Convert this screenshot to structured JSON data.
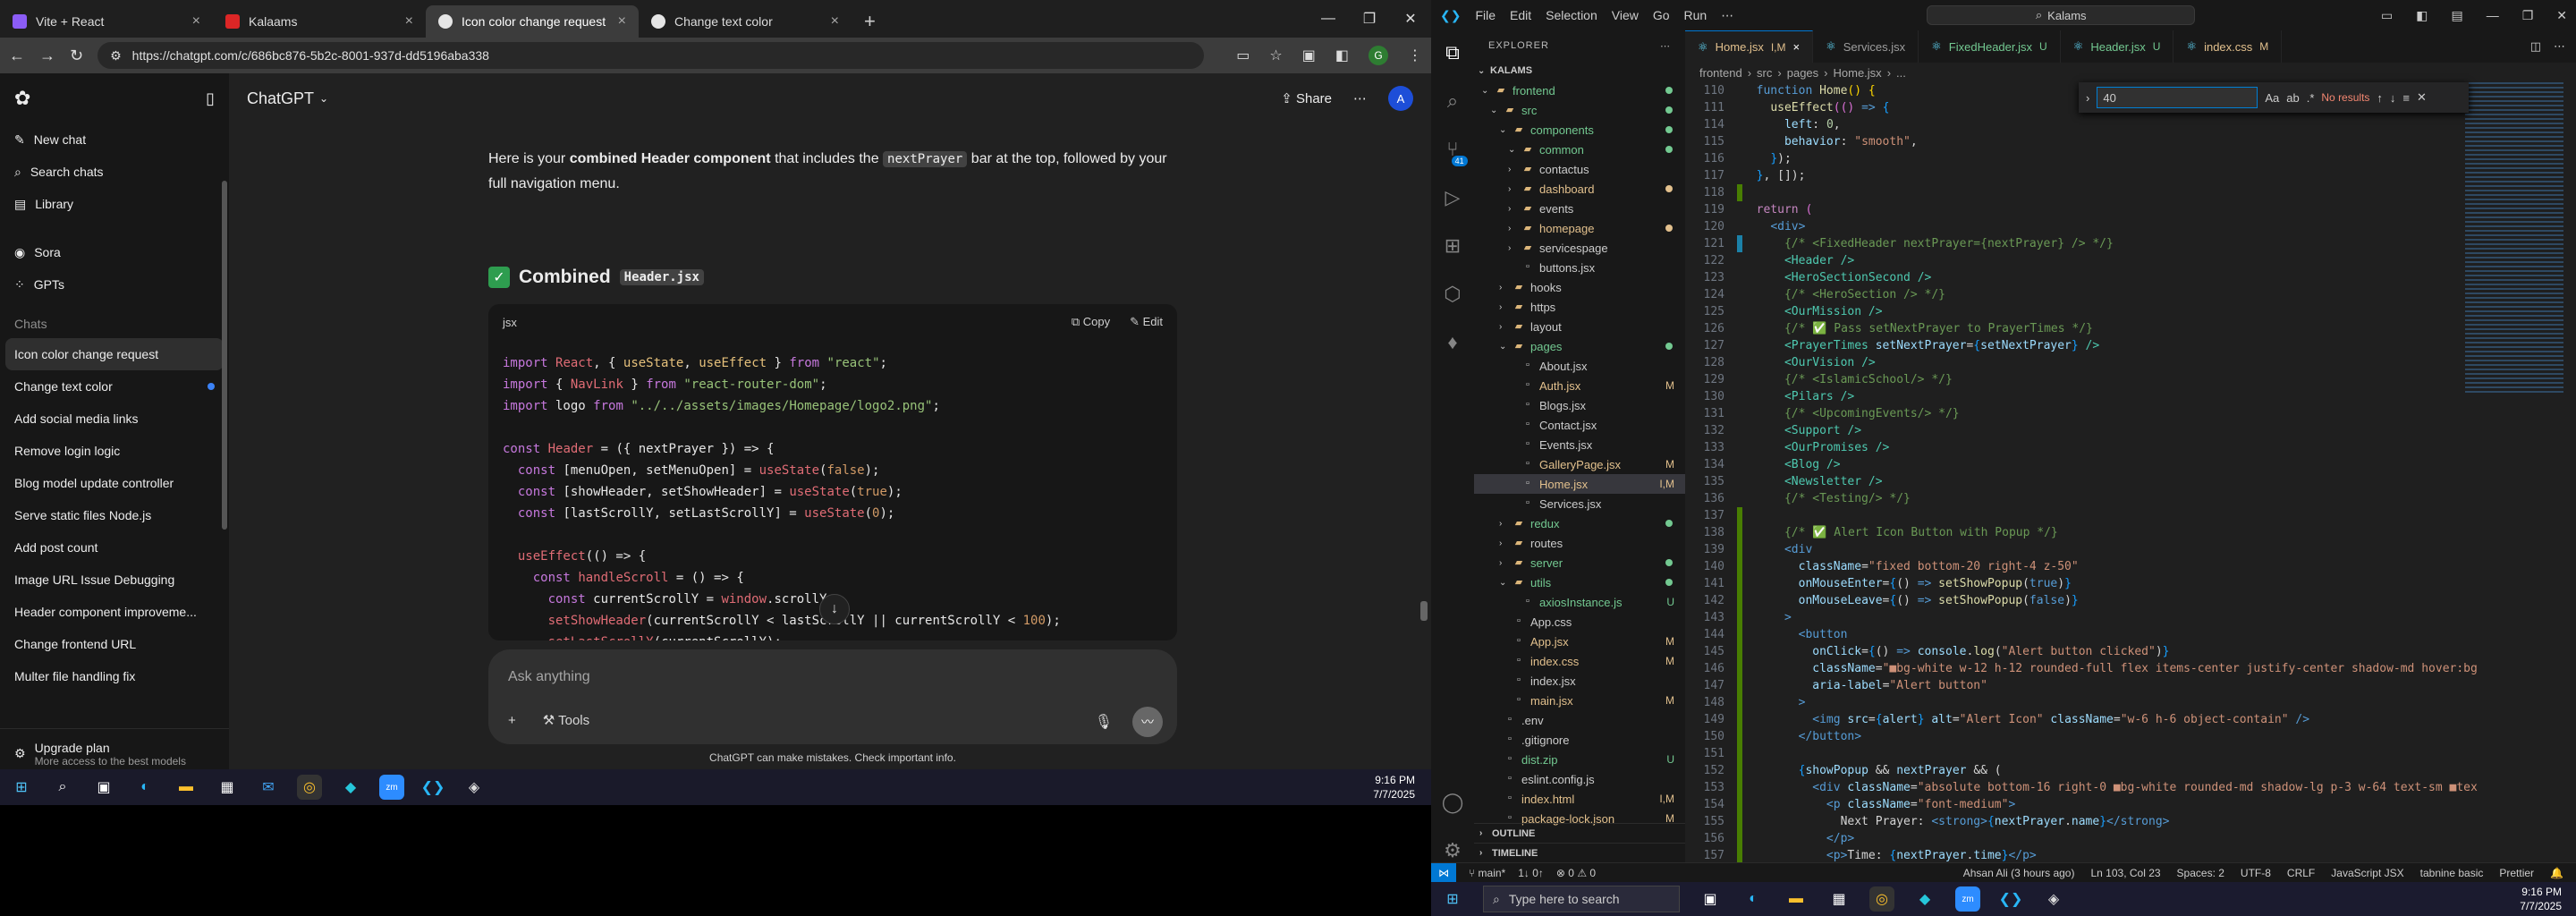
{
  "browser": {
    "tabs": [
      {
        "label": "Vite + React",
        "color": "#8b5cf6"
      },
      {
        "label": "Kalaams",
        "color": "#dc2626"
      },
      {
        "label": "Icon color change request",
        "color": "#e5e5e5"
      },
      {
        "label": "Change text color",
        "color": "#e5e5e5"
      }
    ],
    "url": "https://chatgpt.com/c/686bc876-5b2c-8001-937d-dd5196aba338",
    "profile_initial": "G"
  },
  "chatgpt": {
    "sidebar": {
      "top": [
        {
          "label": "New chat",
          "icon": "new-chat-icon"
        },
        {
          "label": "Search chats",
          "icon": "search-icon"
        },
        {
          "label": "Library",
          "icon": "library-icon"
        }
      ],
      "apps": [
        {
          "label": "Sora",
          "icon": "sora-icon"
        },
        {
          "label": "GPTs",
          "icon": "gpts-icon"
        }
      ],
      "chats_heading": "Chats",
      "chats": [
        "Icon color change request",
        "Change text color",
        "Add social media links",
        "Remove login logic",
        "Blog model update controller",
        "Serve static files Node.js",
        "Add post count",
        "Image URL Issue Debugging",
        "Header component improveme...",
        "Change frontend URL",
        "Multer file handling fix"
      ],
      "upgrade_title": "Upgrade plan",
      "upgrade_sub": "More access to the best models"
    },
    "model": "ChatGPT",
    "share_label": "Share",
    "user_initial": "A",
    "intro_pre": "Here is your ",
    "intro_bold": "combined Header component",
    "intro_mid": " that includes the ",
    "intro_code": "nextPrayer",
    "intro_post": " bar at the top, followed by your full navigation menu.",
    "heading_pre": "Combined",
    "heading_code": "Header.jsx",
    "code_lang": "jsx",
    "copy_label": "Copy",
    "edit_label": "Edit",
    "composer_placeholder": "Ask anything",
    "tools_label": "Tools",
    "disclaimer": "ChatGPT can make mistakes. Check important info."
  },
  "taskbar_left": {
    "time": "9:16 PM",
    "date": "7/7/2025"
  },
  "vscode": {
    "title_search": "Kalams",
    "menu": [
      "File",
      "Edit",
      "Selection",
      "View",
      "Go",
      "Run"
    ],
    "explorer_title": "EXPLORER",
    "root": "KALAMS",
    "tree": [
      {
        "name": "frontend",
        "type": "folder",
        "depth": 0,
        "open": true,
        "status": "",
        "color": "#73c991"
      },
      {
        "name": "src",
        "type": "folder",
        "depth": 1,
        "open": true,
        "status": "",
        "color": "#73c991"
      },
      {
        "name": "components",
        "type": "folder",
        "depth": 2,
        "open": true,
        "status": "",
        "color": "#73c991"
      },
      {
        "name": "common",
        "type": "folder",
        "depth": 3,
        "open": true,
        "status": "",
        "color": "#73c991"
      },
      {
        "name": "contactus",
        "type": "folder",
        "depth": 3,
        "open": false,
        "status": "",
        "color": ""
      },
      {
        "name": "dashboard",
        "type": "folder",
        "depth": 3,
        "open": false,
        "status": "",
        "color": "#e2c08d"
      },
      {
        "name": "events",
        "type": "folder",
        "depth": 3,
        "open": false,
        "status": "",
        "color": ""
      },
      {
        "name": "homepage",
        "type": "folder",
        "depth": 3,
        "open": false,
        "status": "",
        "color": "#e2c08d"
      },
      {
        "name": "servicespage",
        "type": "folder",
        "depth": 3,
        "open": false,
        "status": "",
        "color": ""
      },
      {
        "name": "buttons.jsx",
        "type": "file",
        "depth": 3,
        "open": false,
        "status": "",
        "color": ""
      },
      {
        "name": "hooks",
        "type": "folder",
        "depth": 2,
        "open": false,
        "status": "",
        "color": ""
      },
      {
        "name": "https",
        "type": "folder",
        "depth": 2,
        "open": false,
        "status": "",
        "color": ""
      },
      {
        "name": "layout",
        "type": "folder",
        "depth": 2,
        "open": false,
        "status": "",
        "color": ""
      },
      {
        "name": "pages",
        "type": "folder",
        "depth": 2,
        "open": true,
        "status": "",
        "color": "#73c991"
      },
      {
        "name": "About.jsx",
        "type": "file",
        "depth": 3,
        "open": false,
        "status": "",
        "color": ""
      },
      {
        "name": "Auth.jsx",
        "type": "file",
        "depth": 3,
        "open": false,
        "status": "M",
        "color": "#e2c08d"
      },
      {
        "name": "Blogs.jsx",
        "type": "file",
        "depth": 3,
        "open": false,
        "status": "",
        "color": ""
      },
      {
        "name": "Contact.jsx",
        "type": "file",
        "depth": 3,
        "open": false,
        "status": "",
        "color": ""
      },
      {
        "name": "Events.jsx",
        "type": "file",
        "depth": 3,
        "open": false,
        "status": "",
        "color": ""
      },
      {
        "name": "GalleryPage.jsx",
        "type": "file",
        "depth": 3,
        "open": false,
        "status": "M",
        "color": "#e2c08d"
      },
      {
        "name": "Home.jsx",
        "type": "file",
        "depth": 3,
        "open": false,
        "status": "I,M",
        "color": "#e2c08d",
        "selected": true
      },
      {
        "name": "Services.jsx",
        "type": "file",
        "depth": 3,
        "open": false,
        "status": "",
        "color": ""
      },
      {
        "name": "redux",
        "type": "folder",
        "depth": 2,
        "open": false,
        "status": "",
        "color": "#73c991"
      },
      {
        "name": "routes",
        "type": "folder",
        "depth": 2,
        "open": false,
        "status": "",
        "color": ""
      },
      {
        "name": "server",
        "type": "folder",
        "depth": 2,
        "open": false,
        "status": "",
        "color": "#73c991"
      },
      {
        "name": "utils",
        "type": "folder",
        "depth": 2,
        "open": true,
        "status": "",
        "color": "#73c991"
      },
      {
        "name": "axiosInstance.js",
        "type": "file",
        "depth": 3,
        "open": false,
        "status": "U",
        "color": "#73c991"
      },
      {
        "name": "App.css",
        "type": "file",
        "depth": 2,
        "open": false,
        "status": "",
        "color": ""
      },
      {
        "name": "App.jsx",
        "type": "file",
        "depth": 2,
        "open": false,
        "status": "M",
        "color": "#e2c08d"
      },
      {
        "name": "index.css",
        "type": "file",
        "depth": 2,
        "open": false,
        "status": "M",
        "color": "#e2c08d"
      },
      {
        "name": "index.jsx",
        "type": "file",
        "depth": 2,
        "open": false,
        "status": "",
        "color": ""
      },
      {
        "name": "main.jsx",
        "type": "file",
        "depth": 2,
        "open": false,
        "status": "M",
        "color": "#e2c08d"
      },
      {
        "name": ".env",
        "type": "file",
        "depth": 1,
        "open": false,
        "status": "",
        "color": ""
      },
      {
        "name": ".gitignore",
        "type": "file",
        "depth": 1,
        "open": false,
        "status": "",
        "color": ""
      },
      {
        "name": "dist.zip",
        "type": "file",
        "depth": 1,
        "open": false,
        "status": "U",
        "color": "#73c991"
      },
      {
        "name": "eslint.config.js",
        "type": "file",
        "depth": 1,
        "open": false,
        "status": "",
        "color": ""
      },
      {
        "name": "index.html",
        "type": "file",
        "depth": 1,
        "open": false,
        "status": "I,M",
        "color": "#e2c08d"
      },
      {
        "name": "package-lock.json",
        "type": "file",
        "depth": 1,
        "open": false,
        "status": "M",
        "color": "#e2c08d"
      }
    ],
    "outline": "OUTLINE",
    "timeline": "TIMELINE",
    "tabs": [
      {
        "label": "Home.jsx",
        "status": "I,M",
        "active": true,
        "color": "#e2c08d"
      },
      {
        "label": "Services.jsx",
        "status": "",
        "active": false,
        "color": "#9d9d9d"
      },
      {
        "label": "FixedHeader.jsx",
        "status": "U",
        "active": false,
        "color": "#73c991"
      },
      {
        "label": "Header.jsx",
        "status": "U",
        "active": false,
        "color": "#73c991"
      },
      {
        "label": "index.css",
        "status": "M",
        "active": false,
        "color": "#e2c08d"
      }
    ],
    "breadcrumb": [
      "frontend",
      "src",
      "pages",
      "Home.jsx",
      "..."
    ],
    "find_value": "40",
    "find_result": "No results",
    "status": {
      "branch": "main*",
      "sync": "1↓ 0↑",
      "problems": "⊗ 0 ⚠ 0",
      "author": "Ahsan Ali (3 hours ago)",
      "position": "Ln 103, Col 23",
      "spaces": "Spaces: 2",
      "encoding": "UTF-8",
      "eol": "CRLF",
      "language": "JavaScript JSX",
      "tabnine": "tabnine basic",
      "prettier": "Prettier"
    }
  },
  "taskbar_right": {
    "search_placeholder": "Type here to search",
    "time": "9:16 PM",
    "date": "7/7/2025"
  }
}
